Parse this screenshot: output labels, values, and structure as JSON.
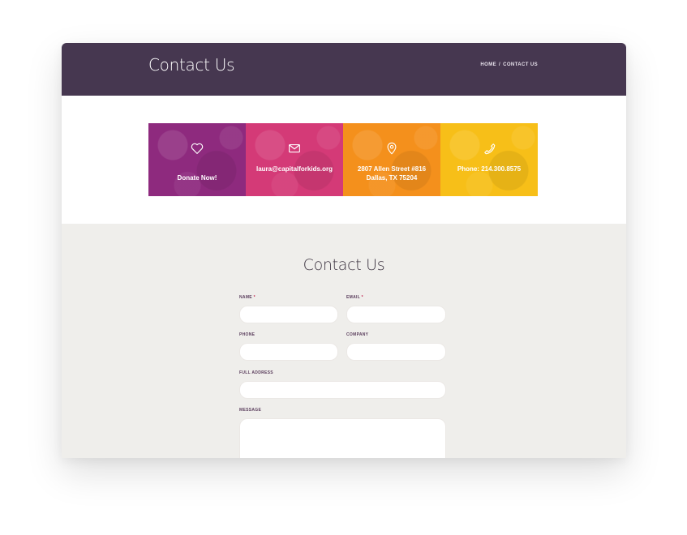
{
  "header": {
    "title": "Contact Us",
    "breadcrumb": {
      "home": "HOME",
      "separator": "/",
      "current": "CONTACT US"
    },
    "background": "#463750"
  },
  "tiles": [
    {
      "icon": "heart-icon",
      "lines": [
        "Donate Now!"
      ],
      "color": "#8e2a7e"
    },
    {
      "icon": "envelope-icon",
      "lines": [
        "laura@capitalforkids.org"
      ],
      "color": "#d43a77"
    },
    {
      "icon": "map-pin-icon",
      "lines": [
        "2807 Allen Street #816",
        "Dallas, TX 75204"
      ],
      "color": "#f4901c"
    },
    {
      "icon": "phone-icon",
      "lines": [
        "Phone: 214.300.8575"
      ],
      "color": "#f7bf18"
    }
  ],
  "form": {
    "title": "Contact Us",
    "background": "#efeeeb",
    "required_marker": "*",
    "fields": {
      "name": {
        "label": "NAME",
        "value": ""
      },
      "email": {
        "label": "EMAIL",
        "value": ""
      },
      "phone": {
        "label": "PHONE",
        "value": ""
      },
      "company": {
        "label": "COMPANY",
        "value": ""
      },
      "address": {
        "label": "FULL ADDRESS",
        "value": ""
      },
      "message": {
        "label": "MESSAGE",
        "value": ""
      }
    }
  }
}
